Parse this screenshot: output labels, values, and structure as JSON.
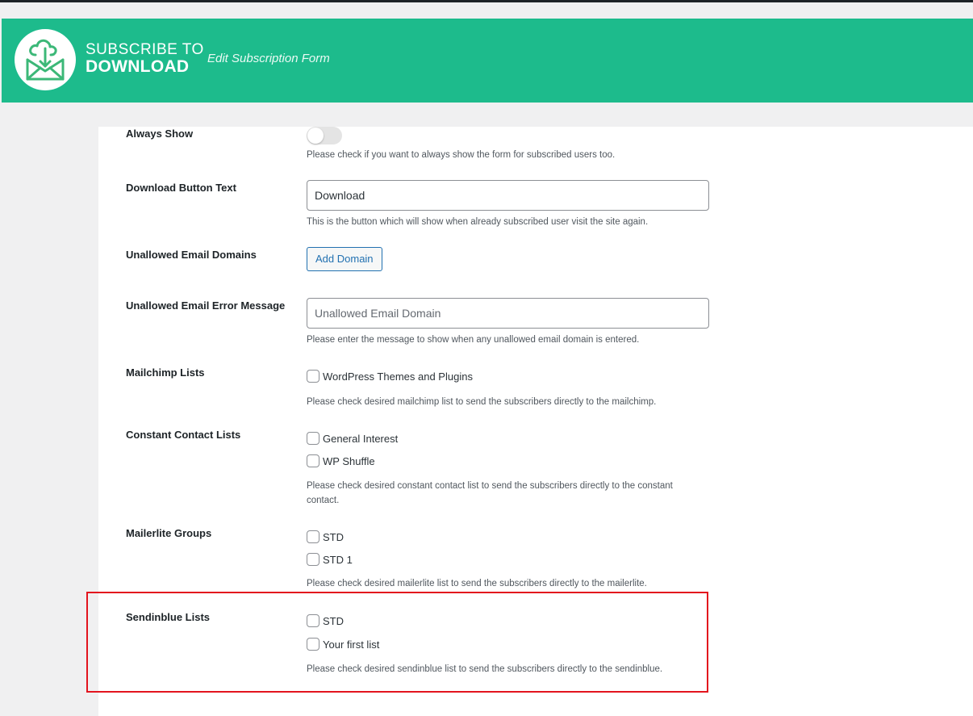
{
  "header": {
    "brand_line1": "SUBSCRIBE TO",
    "brand_line2": "DOWNLOAD",
    "subtitle": "Edit Subscription Form",
    "bg_color": "#1dbb8c",
    "logo_icon": "envelope-download-icon"
  },
  "fields": {
    "always_show": {
      "label": "Always Show",
      "toggle_on": false,
      "description": "Please check if you want to always show the form for subscribed users too."
    },
    "download_button_text": {
      "label": "Download Button Text",
      "value": "Download",
      "description": "This is the button which will show when already subscribed user visit the site again."
    },
    "unallowed_domains": {
      "label": "Unallowed Email Domains",
      "button": "Add Domain"
    },
    "unallowed_error": {
      "label": "Unallowed Email Error Message",
      "placeholder": "Unallowed Email Domain",
      "description": "Please enter the message to show when any unallowed email domain is entered."
    },
    "mailchimp": {
      "label": "Mailchimp Lists",
      "options": [
        "WordPress Themes and Plugins"
      ],
      "description": "Please check desired mailchimp list to send the subscribers directly to the mailchimp."
    },
    "constant_contact": {
      "label": "Constant Contact Lists",
      "options": [
        "General Interest",
        "WP Shuffle"
      ],
      "description": "Please check desired constant contact list to send the subscribers directly to the constant contact."
    },
    "mailerlite": {
      "label": "Mailerlite Groups",
      "options": [
        "STD",
        "STD 1"
      ],
      "description": "Please check desired mailerlite list to send the subscribers directly to the mailerlite."
    },
    "sendinblue": {
      "label": "Sendinblue Lists",
      "options": [
        "STD",
        "Your first list"
      ],
      "description": "Please check desired sendinblue list to send the subscribers directly to the sendinblue."
    }
  },
  "highlight_color": "#e3141e"
}
